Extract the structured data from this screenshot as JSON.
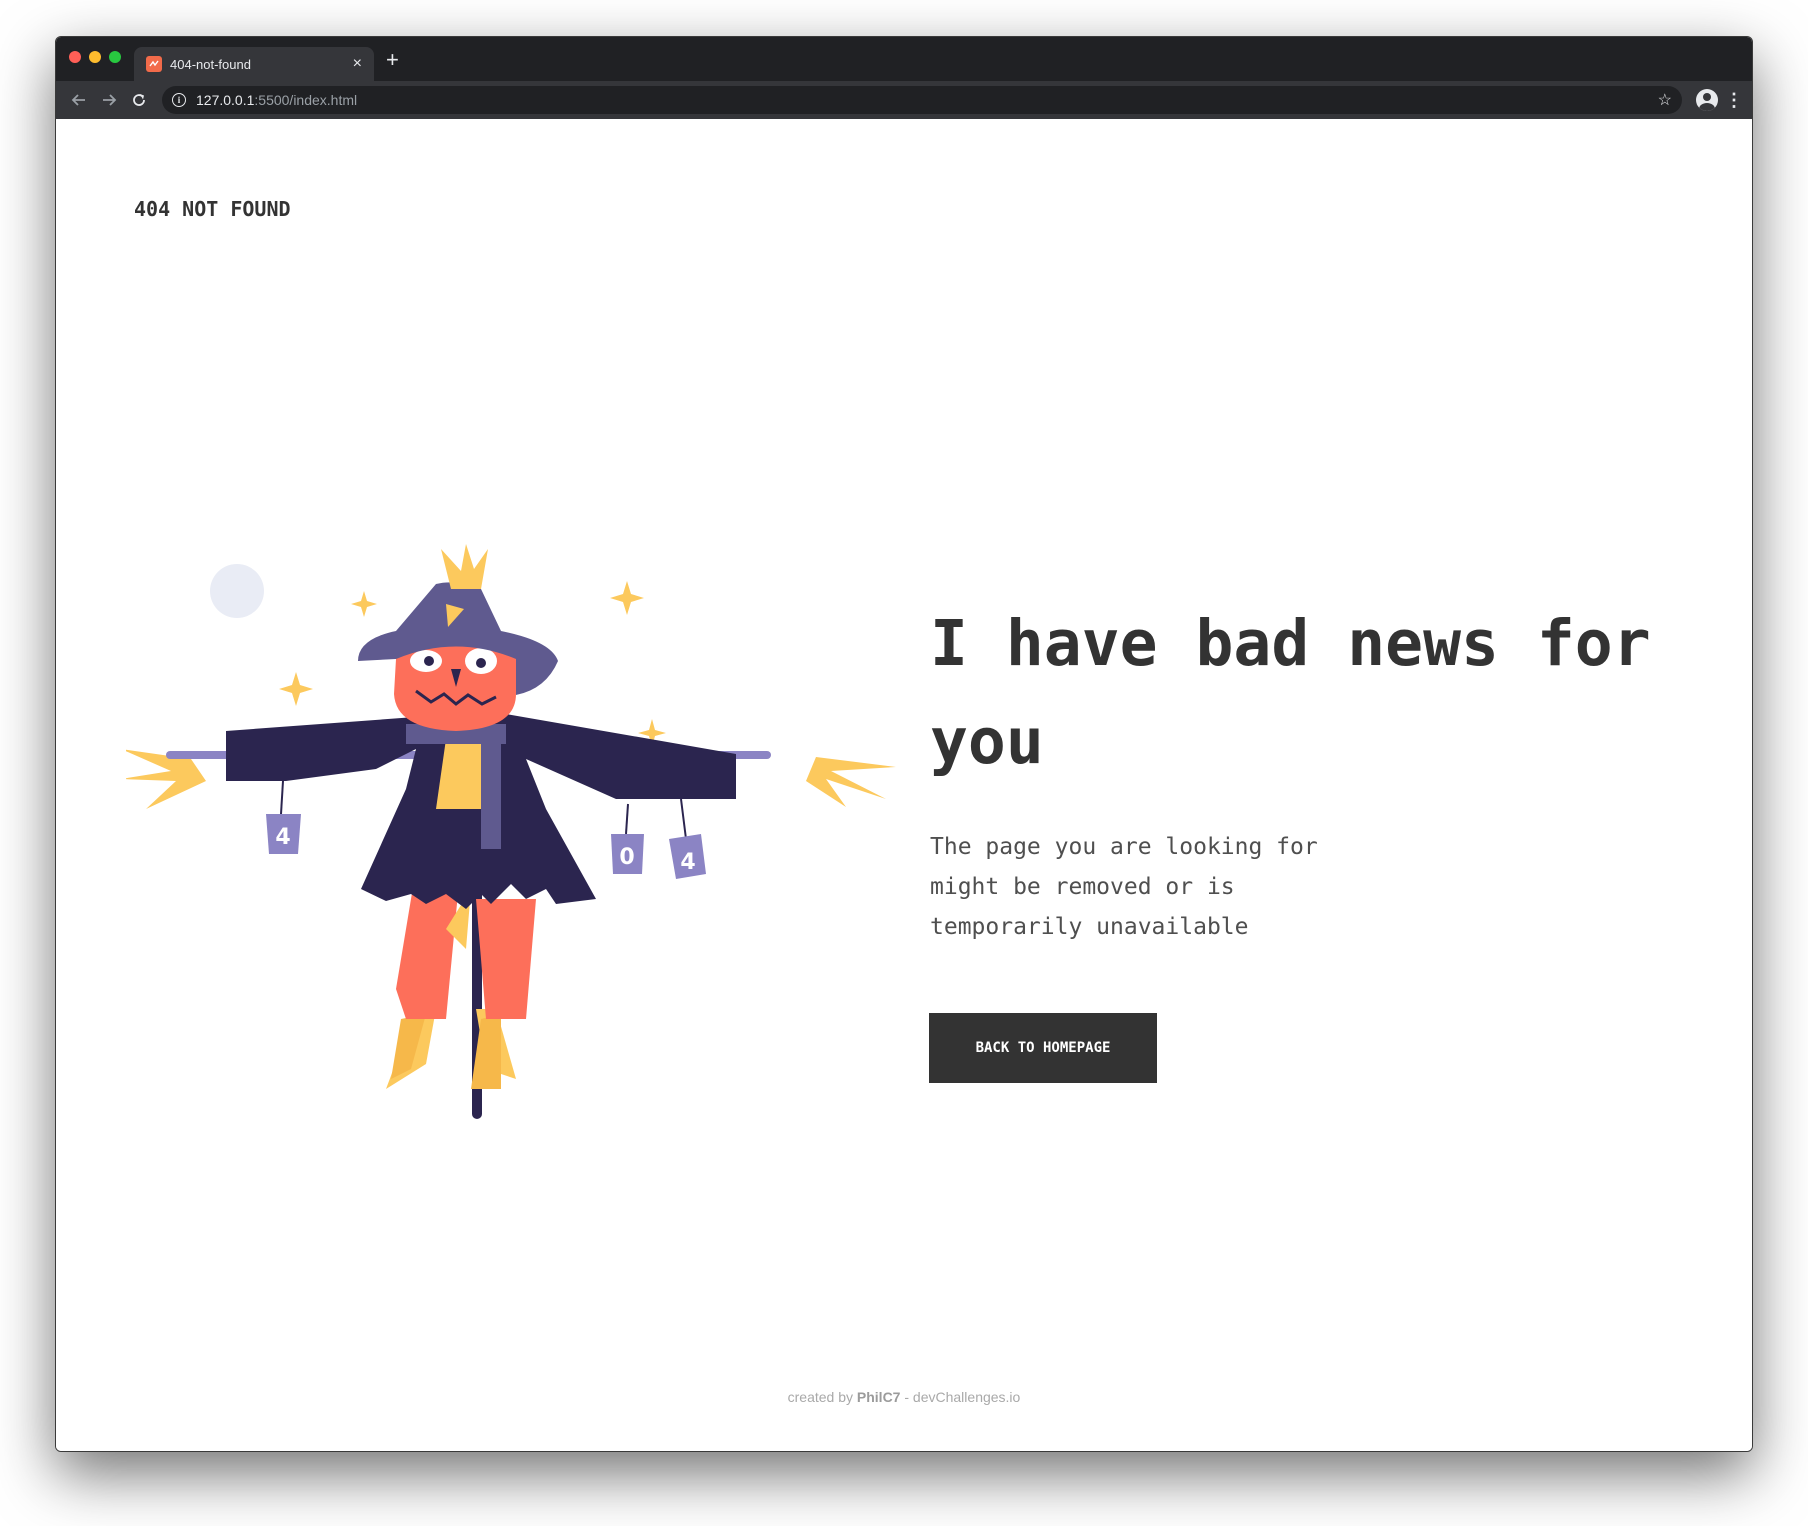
{
  "browser": {
    "tab_title": "404-not-found",
    "tab_close": "×",
    "new_tab": "+",
    "url_host": "127.0.0.1",
    "url_rest": ":5500/index.html",
    "star": "☆",
    "menu": "⋮"
  },
  "page": {
    "brand": "404 NOT FOUND",
    "headline": "I have bad news for you",
    "description": "The page you are looking for might be removed or is temporarily unavailable",
    "button_label": "BACK TO HOMEPAGE",
    "footer": {
      "prefix": "created by",
      "author": "PhilC7",
      "suffix": "- devChallenges.io"
    },
    "can_labels": [
      "4",
      "0",
      "4"
    ]
  },
  "colors": {
    "text_dark": "#333333",
    "scarecrow_face": "#fd6f5a",
    "hat": "#5f5a8f",
    "coat": "#2b254f",
    "straw": "#fcc95d",
    "moon": "#e9ecf5"
  }
}
